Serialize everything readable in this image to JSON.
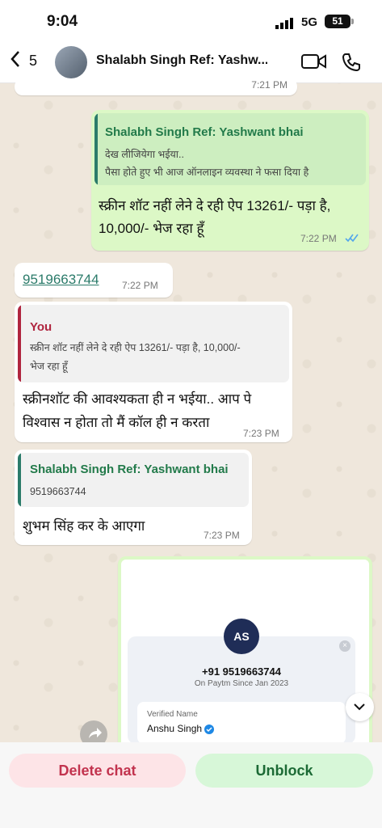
{
  "status": {
    "time": "9:04",
    "network": "5G",
    "battery": "51"
  },
  "header": {
    "back_count": "5",
    "title": "Shalabh Singh Ref: Yashw..."
  },
  "messages": {
    "top_time": "7:21 PM",
    "m1": {
      "quote_name": "Shalabh Singh Ref: Yashwant bhai",
      "quote_lines": [
        "देख लीजियेगा भईया..",
        "पैसा होते हुए भी आज ऑनलाइन व्यवस्था ने फसा दिया है"
      ],
      "text_lines": [
        "स्क्रीन शॉट नहीं लेने दे रही ऐप 13261/- पड़ा है,",
        "10,000/- भेज रहा हूँ"
      ],
      "time": "7:22 PM"
    },
    "m2": {
      "text": "9519663744",
      "time": "7:22 PM"
    },
    "m3": {
      "quote_name": "You",
      "quote_lines": [
        "स्क्रीन शॉट नहीं लेने दे रही ऐप 13261/- पड़ा है, 10,000/-",
        "भेज रहा हूँ"
      ],
      "text_lines": [
        "स्क्रीनशॉट की आवश्यकता ही न भईया.. आप पे",
        "विश्वास न होता तो मैं कॉल ही न करता"
      ],
      "time": "7:23 PM"
    },
    "m4": {
      "quote_name": "Shalabh Singh Ref: Yashwant bhai",
      "quote_line": "9519663744",
      "text": "शुभम सिंह कर के आएगा",
      "time": "7:23 PM"
    },
    "card": {
      "initials": "AS",
      "phone": "+91 9519663744",
      "subtitle": "On Paytm Since Jan 2023",
      "verified_label": "Verified Name",
      "name": "Anshu Singh"
    }
  },
  "actions": {
    "delete": "Delete chat",
    "unblock": "Unblock"
  },
  "colors": {
    "accent": "#2b7b6a",
    "out_bubble": "#dcf8c6",
    "danger": "#c2334e",
    "verified": "#1e88e5"
  }
}
